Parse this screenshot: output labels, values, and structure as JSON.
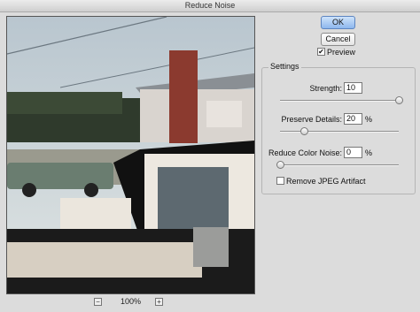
{
  "window": {
    "title": "Reduce Noise"
  },
  "buttons": {
    "ok_label": "OK",
    "cancel_label": "Cancel"
  },
  "preview_toggle": {
    "label": "Preview",
    "checked": true,
    "mark": "✔"
  },
  "zoom": {
    "minus": "−",
    "plus": "+",
    "level": "100%"
  },
  "settings": {
    "group_title": "Settings",
    "strength": {
      "label": "Strength:",
      "value": "10",
      "unit": "",
      "fraction": 1.0
    },
    "preserve_details": {
      "label": "Preserve Details:",
      "value": "20",
      "unit": "%",
      "fraction": 0.2
    },
    "reduce_color_noise": {
      "label": "Reduce Color Noise:",
      "value": "0",
      "unit": "%",
      "fraction": 0.0
    },
    "remove_jpeg": {
      "label": "Remove JPEG Artifact",
      "checked": false
    }
  },
  "icons": {
    "zoom_out": "zoom-out-icon",
    "zoom_in": "zoom-in-icon",
    "checkmark": "checkmark-icon"
  }
}
